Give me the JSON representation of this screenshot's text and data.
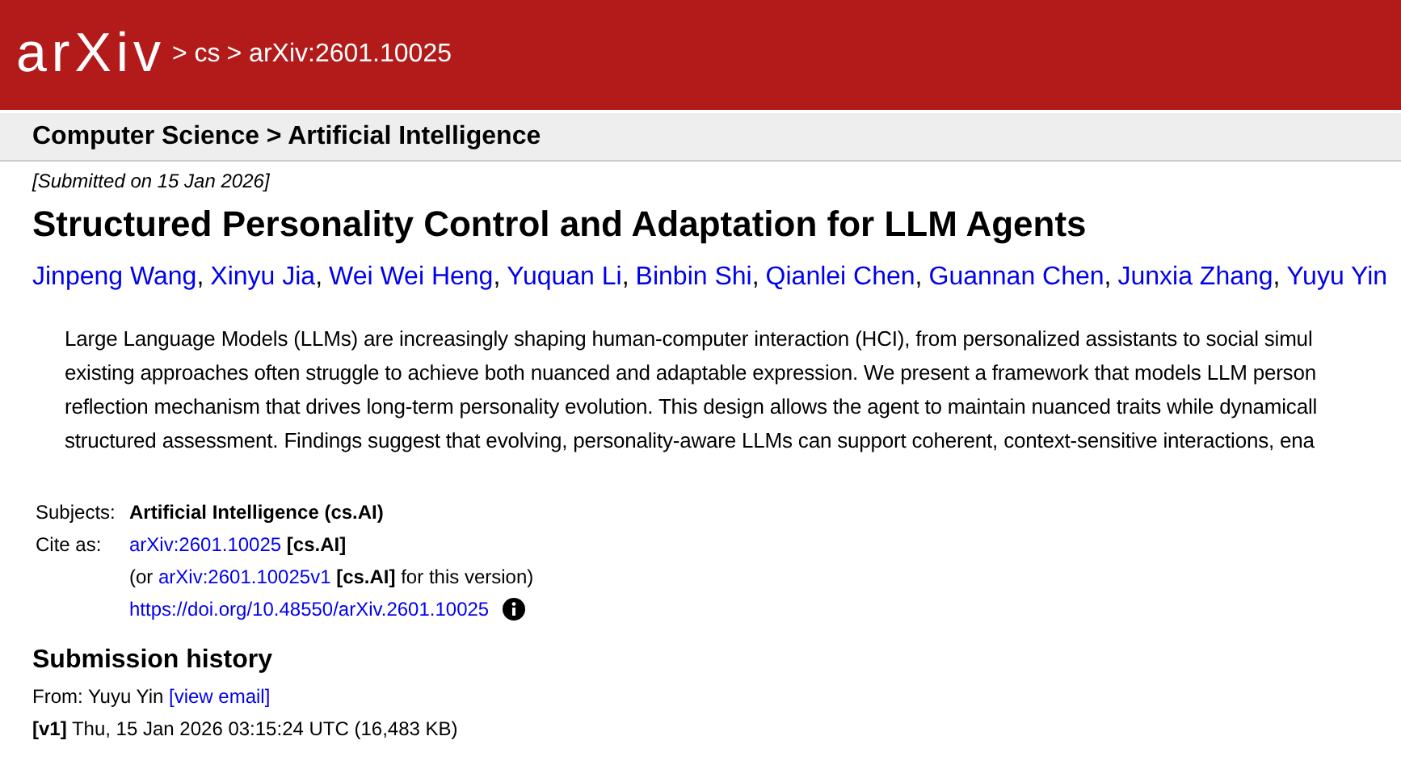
{
  "header": {
    "logo": "arXiv",
    "breadcrumbs": [
      "> cs",
      "> arXiv:2601.10025"
    ]
  },
  "subheader": {
    "title": "Computer Science > Artificial Intelligence"
  },
  "submitted": "[Submitted on 15 Jan 2026]",
  "title": "Structured Personality Control and Adaptation for LLM Agents",
  "authors": {
    "separator": ",",
    "names": [
      "Jinpeng Wang",
      "Xinyu Jia",
      "Wei Wei Heng",
      "Yuquan Li",
      "Binbin Shi",
      "Qianlei Chen",
      "Guannan Chen",
      "Junxia Zhang",
      "Yuyu Yin"
    ]
  },
  "abstract_lines": [
    "Large Language Models (LLMs) are increasingly shaping human-computer interaction (HCI), from personalized assistants to social simul",
    "existing approaches often struggle to achieve both nuanced and adaptable expression. We present a framework that models LLM person",
    "reflection mechanism that drives long-term personality evolution. This design allows the agent to maintain nuanced traits while dynamicall",
    "structured assessment. Findings suggest that evolving, personality-aware LLMs can support coherent, context-sensitive interactions, ena"
  ],
  "metadata": [
    {
      "label": "Subjects:",
      "lines": [
        [
          {
            "kind": "bold",
            "text": "Artificial Intelligence (cs.AI)"
          }
        ]
      ]
    },
    {
      "label": "Cite as:",
      "lines": [
        [
          {
            "kind": "link",
            "text": "arXiv:2601.10025"
          },
          {
            "kind": "bold",
            "text": " [cs.AI]"
          }
        ],
        [
          {
            "kind": "text",
            "text": "(or "
          },
          {
            "kind": "link",
            "text": "arXiv:2601.10025v1"
          },
          {
            "kind": "bold",
            "text": " [cs.AI]"
          },
          {
            "kind": "text",
            "text": " for this version)"
          }
        ],
        [
          {
            "kind": "link",
            "text": "https://doi.org/10.48550/arXiv.2601.10025"
          },
          {
            "kind": "info"
          }
        ]
      ]
    }
  ],
  "history": {
    "heading": "Submission history",
    "from_label": "From: Yuyu Yin ",
    "email_link": "[view email]",
    "versions": [
      {
        "tag": "[v1]",
        "text": " Thu, 15 Jan 2026 03:15:24 UTC (16,483 KB)"
      }
    ]
  }
}
